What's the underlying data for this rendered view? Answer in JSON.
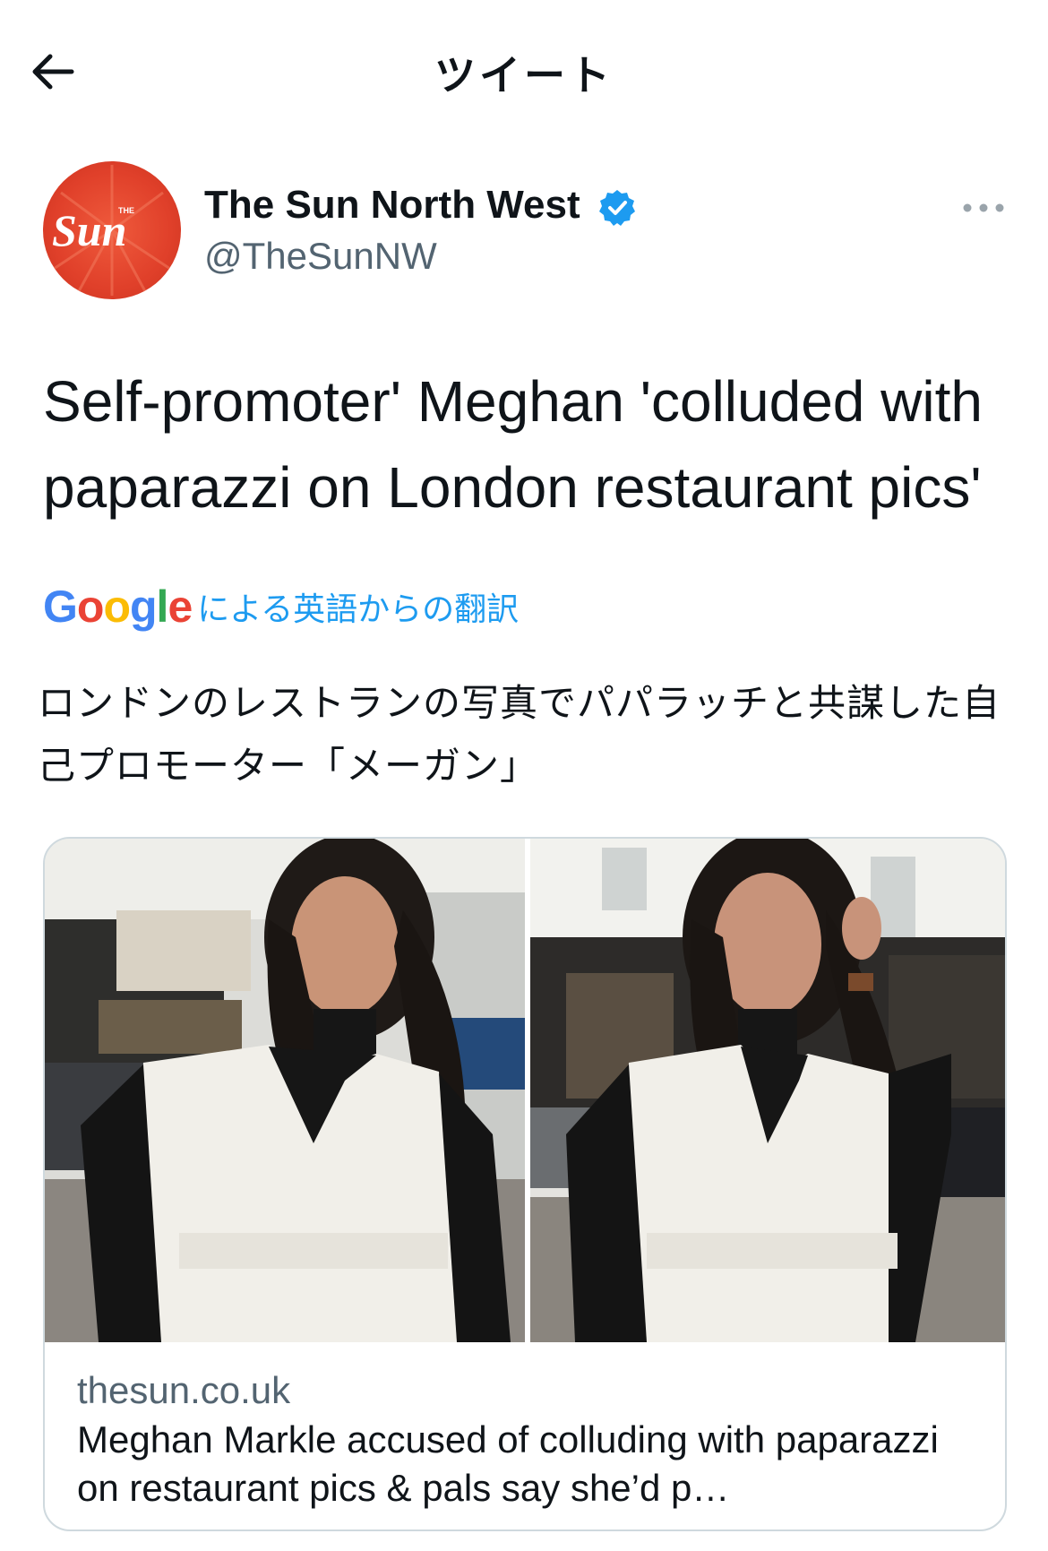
{
  "header": {
    "back_label": "Back",
    "title": "ツイート"
  },
  "account": {
    "avatar_text": "Sun",
    "avatar_small_text": "THE",
    "display_name": "The Sun North West",
    "handle": "@TheSunNW",
    "verified": true
  },
  "tweet": {
    "text": "Self-promoter' Meghan 'colluded with paparazzi on London restaurant pics'"
  },
  "translation": {
    "provider": "Google",
    "label": "による英語からの翻訳",
    "text": "ロンドンのレストランの写真でパパラッチと共謀した自己プロモーター「メーガン」"
  },
  "card": {
    "domain": "thesun.co.uk",
    "title": "Meghan Markle accused of colluding with paparazzi on restaurant pics & pals say she’d p…"
  },
  "colors": {
    "accent": "#1d9bf0",
    "text": "#0f1419",
    "secondary_text": "#536471",
    "border": "#cfd9de",
    "brand_red": "#e0402a"
  },
  "icons": {
    "back": "arrow-left-icon",
    "verified": "verified-badge-icon",
    "more": "more-horizontal-icon"
  }
}
